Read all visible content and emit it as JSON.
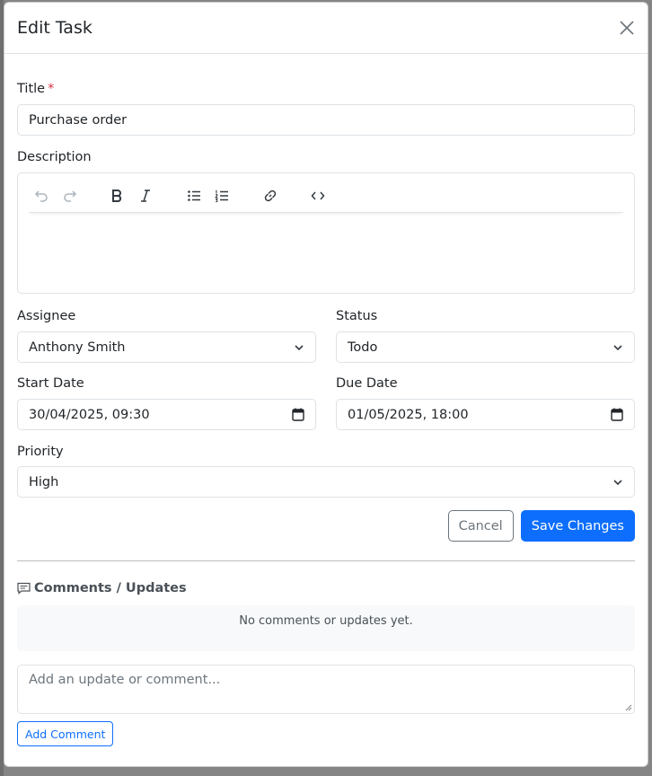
{
  "modal": {
    "title": "Edit Task"
  },
  "form": {
    "title_label": "Title",
    "required_marker": "*",
    "title_value": "Purchase order",
    "description_label": "Description",
    "assignee_label": "Assignee",
    "assignee_value": "Anthony Smith",
    "status_label": "Status",
    "status_value": "Todo",
    "start_date_label": "Start Date",
    "start_date_value": "30/04/2025, 09:30",
    "due_date_label": "Due Date",
    "due_date_value": "01/05/2025, 18:00",
    "priority_label": "Priority",
    "priority_value": "High",
    "cancel_label": "Cancel",
    "save_label": "Save Changes"
  },
  "editor_toolbar": [
    "undo-icon",
    "redo-icon",
    "bold-icon",
    "italic-icon",
    "bullet-list-icon",
    "numbered-list-icon",
    "link-icon",
    "code-icon"
  ],
  "comments": {
    "heading": "Comments / Updates",
    "empty_text": "No comments or updates yet.",
    "placeholder": "Add an update or comment...",
    "add_label": "Add Comment"
  },
  "colors": {
    "primary": "#0d6efd",
    "danger": "#dc3545",
    "secondary": "#6c757d"
  }
}
